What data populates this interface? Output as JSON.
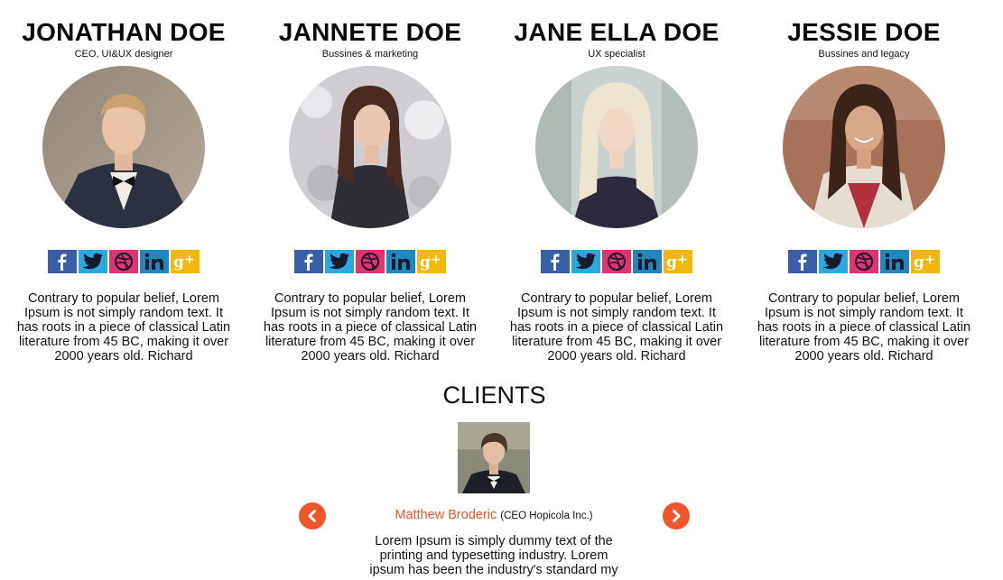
{
  "team": {
    "members": [
      {
        "name": "JONATHAN DOE",
        "role": "CEO, UI&UX designer",
        "bio": "Contrary to popular belief, Lorem Ipsum is not simply random text. It has roots in a piece of classical Latin literature from 45 BC, making it over 2000 years old. Richard"
      },
      {
        "name": "JANNETE DOE",
        "role": "Bussines & marketing",
        "bio": "Contrary to popular belief, Lorem Ipsum is not simply random text. It has roots in a piece of classical Latin literature from 45 BC, making it over 2000 years old. Richard"
      },
      {
        "name": "JANE ELLA DOE",
        "role": "UX specialist",
        "bio": "Contrary to popular belief, Lorem Ipsum is not simply random text. It has roots in a piece of classical Latin literature from 45 BC, making it over 2000 years old. Richard"
      },
      {
        "name": "JESSIE DOE",
        "role": "Bussines and legacy",
        "bio": "Contrary to popular belief, Lorem Ipsum is not simply random text. It has roots in a piece of classical Latin literature from 45 BC, making it over 2000 years old. Richard"
      }
    ],
    "social_icons": [
      "facebook-icon",
      "twitter-icon",
      "dribbble-icon",
      "linkedin-icon",
      "google-plus-icon"
    ]
  },
  "clients": {
    "title": "CLIENTS",
    "client_name": "Matthew Broderic",
    "client_role": "(CEO Hopicola Inc.)",
    "testimonial": "Lorem Ipsum is simply dummy text of the printing and typesetting industry. Lorem ipsum has been the industry's standard my"
  },
  "colors": {
    "facebook": "#3b5ea8",
    "twitter": "#2aa9e0",
    "dribbble": "#e0336f",
    "linkedin": "#1f88be",
    "google_plus": "#f2b807",
    "accent": "#f0552c",
    "client_name": "#e8562a"
  }
}
